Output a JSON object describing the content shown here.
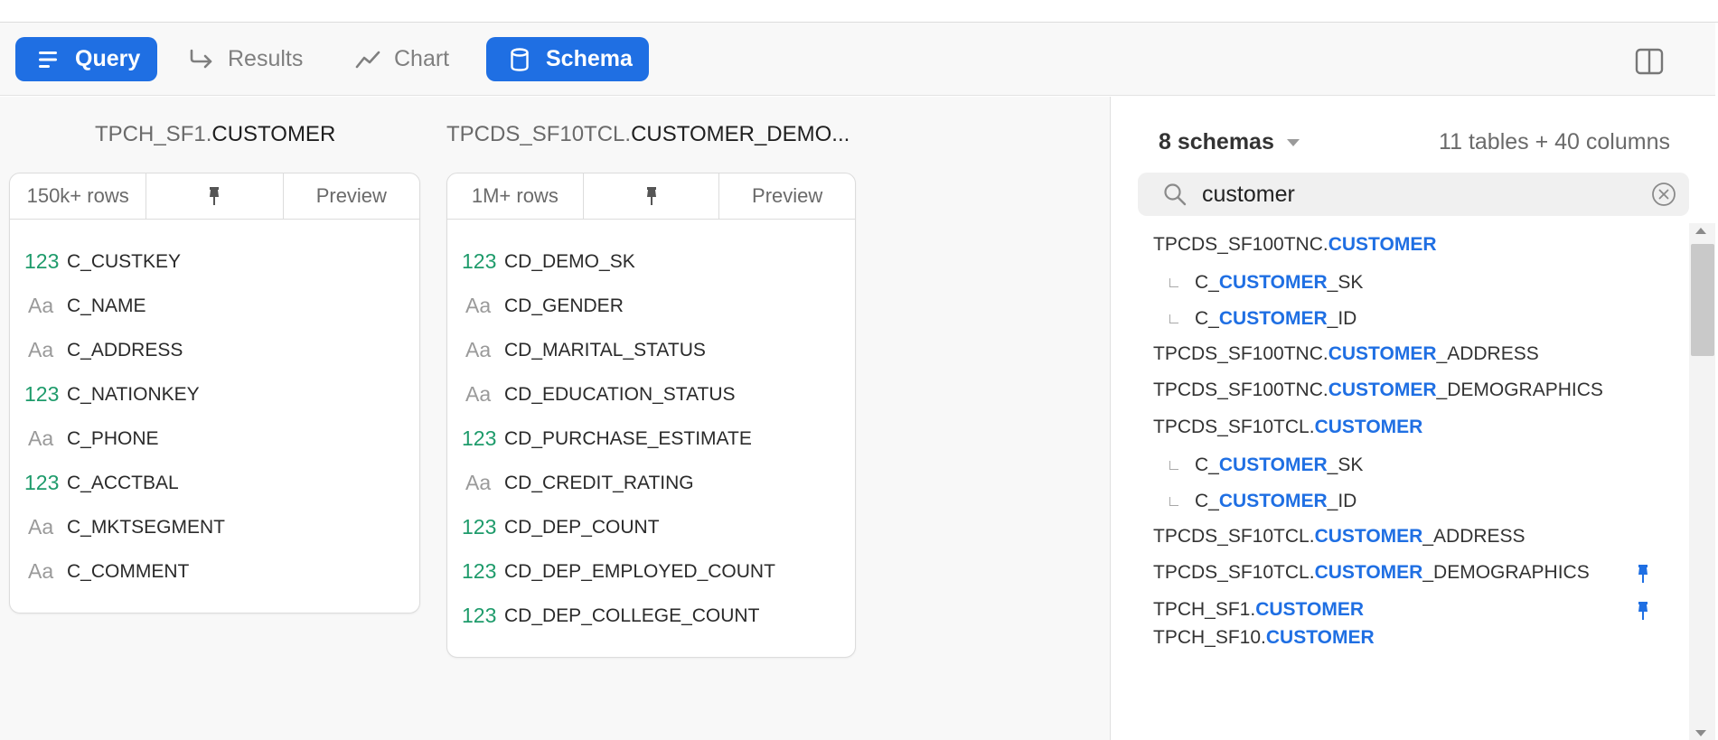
{
  "toolbar": {
    "query_label": "Query",
    "results_label": "Results",
    "chart_label": "Chart",
    "schema_label": "Schema"
  },
  "tables": [
    {
      "schema": "TPCH_SF1.",
      "name": "CUSTOMER",
      "rows": "150k+ rows",
      "preview": "Preview",
      "columns": [
        {
          "type": "123",
          "name": "C_CUSTKEY"
        },
        {
          "type": "Aa",
          "name": "C_NAME"
        },
        {
          "type": "Aa",
          "name": "C_ADDRESS"
        },
        {
          "type": "123",
          "name": "C_NATIONKEY"
        },
        {
          "type": "Aa",
          "name": "C_PHONE"
        },
        {
          "type": "123",
          "name": "C_ACCTBAL"
        },
        {
          "type": "Aa",
          "name": "C_MKTSEGMENT"
        },
        {
          "type": "Aa",
          "name": "C_COMMENT"
        }
      ]
    },
    {
      "schema": "TPCDS_SF10TCL.",
      "name": "CUSTOMER_DEMO...",
      "rows": "1M+ rows",
      "preview": "Preview",
      "columns": [
        {
          "type": "123",
          "name": "CD_DEMO_SK"
        },
        {
          "type": "Aa",
          "name": "CD_GENDER"
        },
        {
          "type": "Aa",
          "name": "CD_MARITAL_STATUS"
        },
        {
          "type": "Aa",
          "name": "CD_EDUCATION_STATUS"
        },
        {
          "type": "123",
          "name": "CD_PURCHASE_ESTIMATE"
        },
        {
          "type": "Aa",
          "name": "CD_CREDIT_RATING"
        },
        {
          "type": "123",
          "name": "CD_DEP_COUNT"
        },
        {
          "type": "123",
          "name": "CD_DEP_EMPLOYED_COUNT"
        },
        {
          "type": "123",
          "name": "CD_DEP_COLLEGE_COUNT"
        }
      ]
    }
  ],
  "sidebar": {
    "schemas_label": "8 schemas",
    "count_label": "11 tables + 40 columns",
    "search_value": "customer",
    "results": [
      {
        "pre": "TPCDS_SF100TNC.",
        "hl": "CUSTOMER",
        "post": "",
        "child": false,
        "pinned": false
      },
      {
        "pre": "C_",
        "hl": "CUSTOMER",
        "post": "_SK",
        "child": true,
        "pinned": false
      },
      {
        "pre": "C_",
        "hl": "CUSTOMER",
        "post": "_ID",
        "child": true,
        "pinned": false
      },
      {
        "pre": "TPCDS_SF100TNC.",
        "hl": "CUSTOMER",
        "post": "_ADDRESS",
        "child": false,
        "pinned": false
      },
      {
        "pre": "TPCDS_SF100TNC.",
        "hl": "CUSTOMER",
        "post": "_DEMOGRAPHICS",
        "child": false,
        "pinned": false
      },
      {
        "pre": "TPCDS_SF10TCL.",
        "hl": "CUSTOMER",
        "post": "",
        "child": false,
        "pinned": false
      },
      {
        "pre": "C_",
        "hl": "CUSTOMER",
        "post": "_SK",
        "child": true,
        "pinned": false
      },
      {
        "pre": "C_",
        "hl": "CUSTOMER",
        "post": "_ID",
        "child": true,
        "pinned": false
      },
      {
        "pre": "TPCDS_SF10TCL.",
        "hl": "CUSTOMER",
        "post": "_ADDRESS",
        "child": false,
        "pinned": false
      },
      {
        "pre": "TPCDS_SF10TCL.",
        "hl": "CUSTOMER",
        "post": "_DEMOGRAPHICS",
        "child": false,
        "pinned": true
      },
      {
        "pre": "TPCH_SF1.",
        "hl": "CUSTOMER",
        "post": "",
        "child": false,
        "pinned": true
      },
      {
        "pre": "TPCH_SF10.",
        "hl": "CUSTOMER",
        "post": "",
        "child": false,
        "pinned": false
      }
    ]
  },
  "colors": {
    "accent": "#1f6fe3",
    "numeric_type": "#1e9b6b",
    "text_type": "#9a9a9a"
  }
}
